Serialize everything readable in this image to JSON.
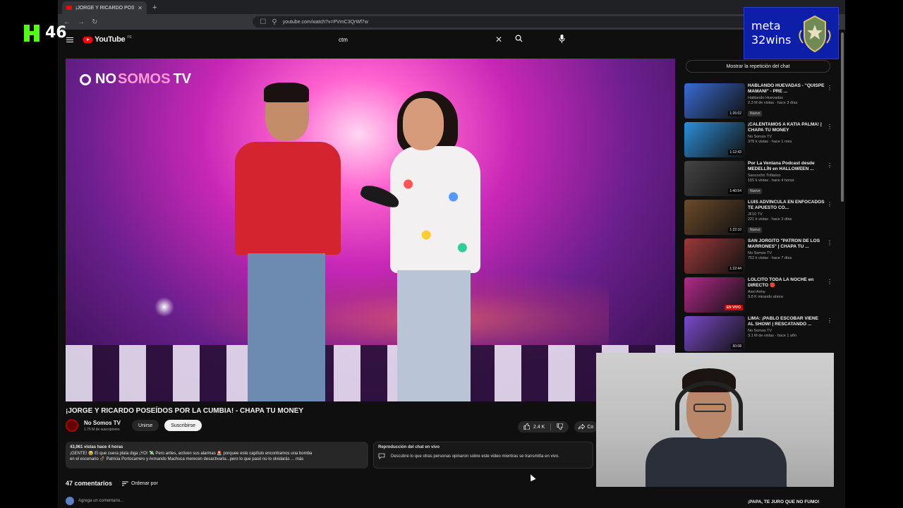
{
  "overlay": {
    "kick_count": "46",
    "goal_text": "meta\n32wins"
  },
  "browser": {
    "tab_title": "¡JORGE Y RICARDO POSEÍDOS",
    "url": "youtube.com/watch?v=PVmC3QrWf7w"
  },
  "youtube": {
    "logo_word": "YouTube",
    "logo_country": "PE",
    "search_query": "ctm"
  },
  "player": {
    "channel_logo_no": "NO",
    "channel_logo_somos": "SOMOS",
    "channel_logo_tv": "TV"
  },
  "video": {
    "title": "¡JORGE Y RICARDO POSEÍDOS POR LA CUMBIA! - CHAPA TU MONEY",
    "channel_name": "No Somos TV",
    "subscribers": "1.75 M de suscriptores",
    "join_label": "Unirse",
    "subscribe_label": "Suscribirse",
    "likes": "2.4 K",
    "share_label": "Co",
    "description_meta": "43,961 vistas hace 4 horas",
    "description_line1": "¡GENTE! 😂 El que cuera plata diga ¡YO! 💸 Pero antes, activen sus alarmas 🚨 porquee este capítulo encontramos una bomba",
    "description_line2": "en el escenario 💣 Patricia Portocarrero y Armando Machuca merecen desactivarla...pero lo que pasó no lo olvidarás ... más"
  },
  "chat_replay": {
    "heading": "Reproducción del chat en vivo",
    "text": "Descubre lo que otras personas opinaron sobre este video mientras se transmitía en vivo."
  },
  "comments": {
    "count_label": "47 comentarios",
    "sort_label": "Ordenar por",
    "add_placeholder": "Agrega un comentario..."
  },
  "sidebar": {
    "chat_button": "Mostrar la repetición del chat",
    "related": [
      {
        "title": "HABLANDO HUEVADAS - \"QUISPE MAMANI\" - PRE ...",
        "channel": "Hablando Huevadas",
        "meta": "2.3 M de vistas · hace 3 días",
        "duration": "1:26:02",
        "badge": "Nuevo",
        "thumb": "#3a6bd1"
      },
      {
        "title": "¡CALENTAMOS A KATIA PALMA! | CHAPA TU MONEY",
        "channel": "No Somos TV",
        "meta": "378 k vistas · hace 1 mes",
        "duration": "1:12:43",
        "badge": "",
        "thumb": "#2e8fd8"
      },
      {
        "title": "Por La Ventana Podcast desde MEDELLÍN en HALLOWEEN ...",
        "channel": "Sancocho Trifásico",
        "meta": "155 k vistas · hace 4 horas",
        "duration": "1:40:54",
        "badge": "Nuevo",
        "thumb": "#444444"
      },
      {
        "title": "LUIS ADVÍNCULA EN ENFOCADOS TE APUESTO CO...",
        "channel": "JF10 TV",
        "meta": "221 k vistas · hace 3 días",
        "duration": "1:22:10",
        "badge": "Nuevo",
        "thumb": "#6b4a2a"
      },
      {
        "title": "SAN JORGITO \"PATRÓN DE LOS MARRONES\" | CHAPA TU ...",
        "channel": "No Somos TV",
        "meta": "752 k vistas · hace 7 días",
        "duration": "1:22:44",
        "badge": "",
        "thumb": "#9a3a3a"
      },
      {
        "title": "LOLCITO TODA LA NOCHE en DIRECTO 🔴",
        "channel": "Axel Army",
        "meta": "3.8 K mirando ahora",
        "duration": "EN VIVO",
        "badge": "",
        "thumb": "#b12a8a"
      },
      {
        "title": "LIMA: ¡PABLO ESCOBAR VIENE AL SHOW! | RESCATANDO ...",
        "channel": "No Somos TV",
        "meta": "3.1 M de vistas · hace 1 año",
        "duration": "50:08",
        "badge": "",
        "thumb": "#7a49c9"
      }
    ],
    "last_title": "¡PAPA, TE JURO QUE NO FUMO!"
  },
  "colors": {
    "kick_green": "#53fc18",
    "yt_red": "#ff0000",
    "goal_blue": "#0d1fa8"
  }
}
